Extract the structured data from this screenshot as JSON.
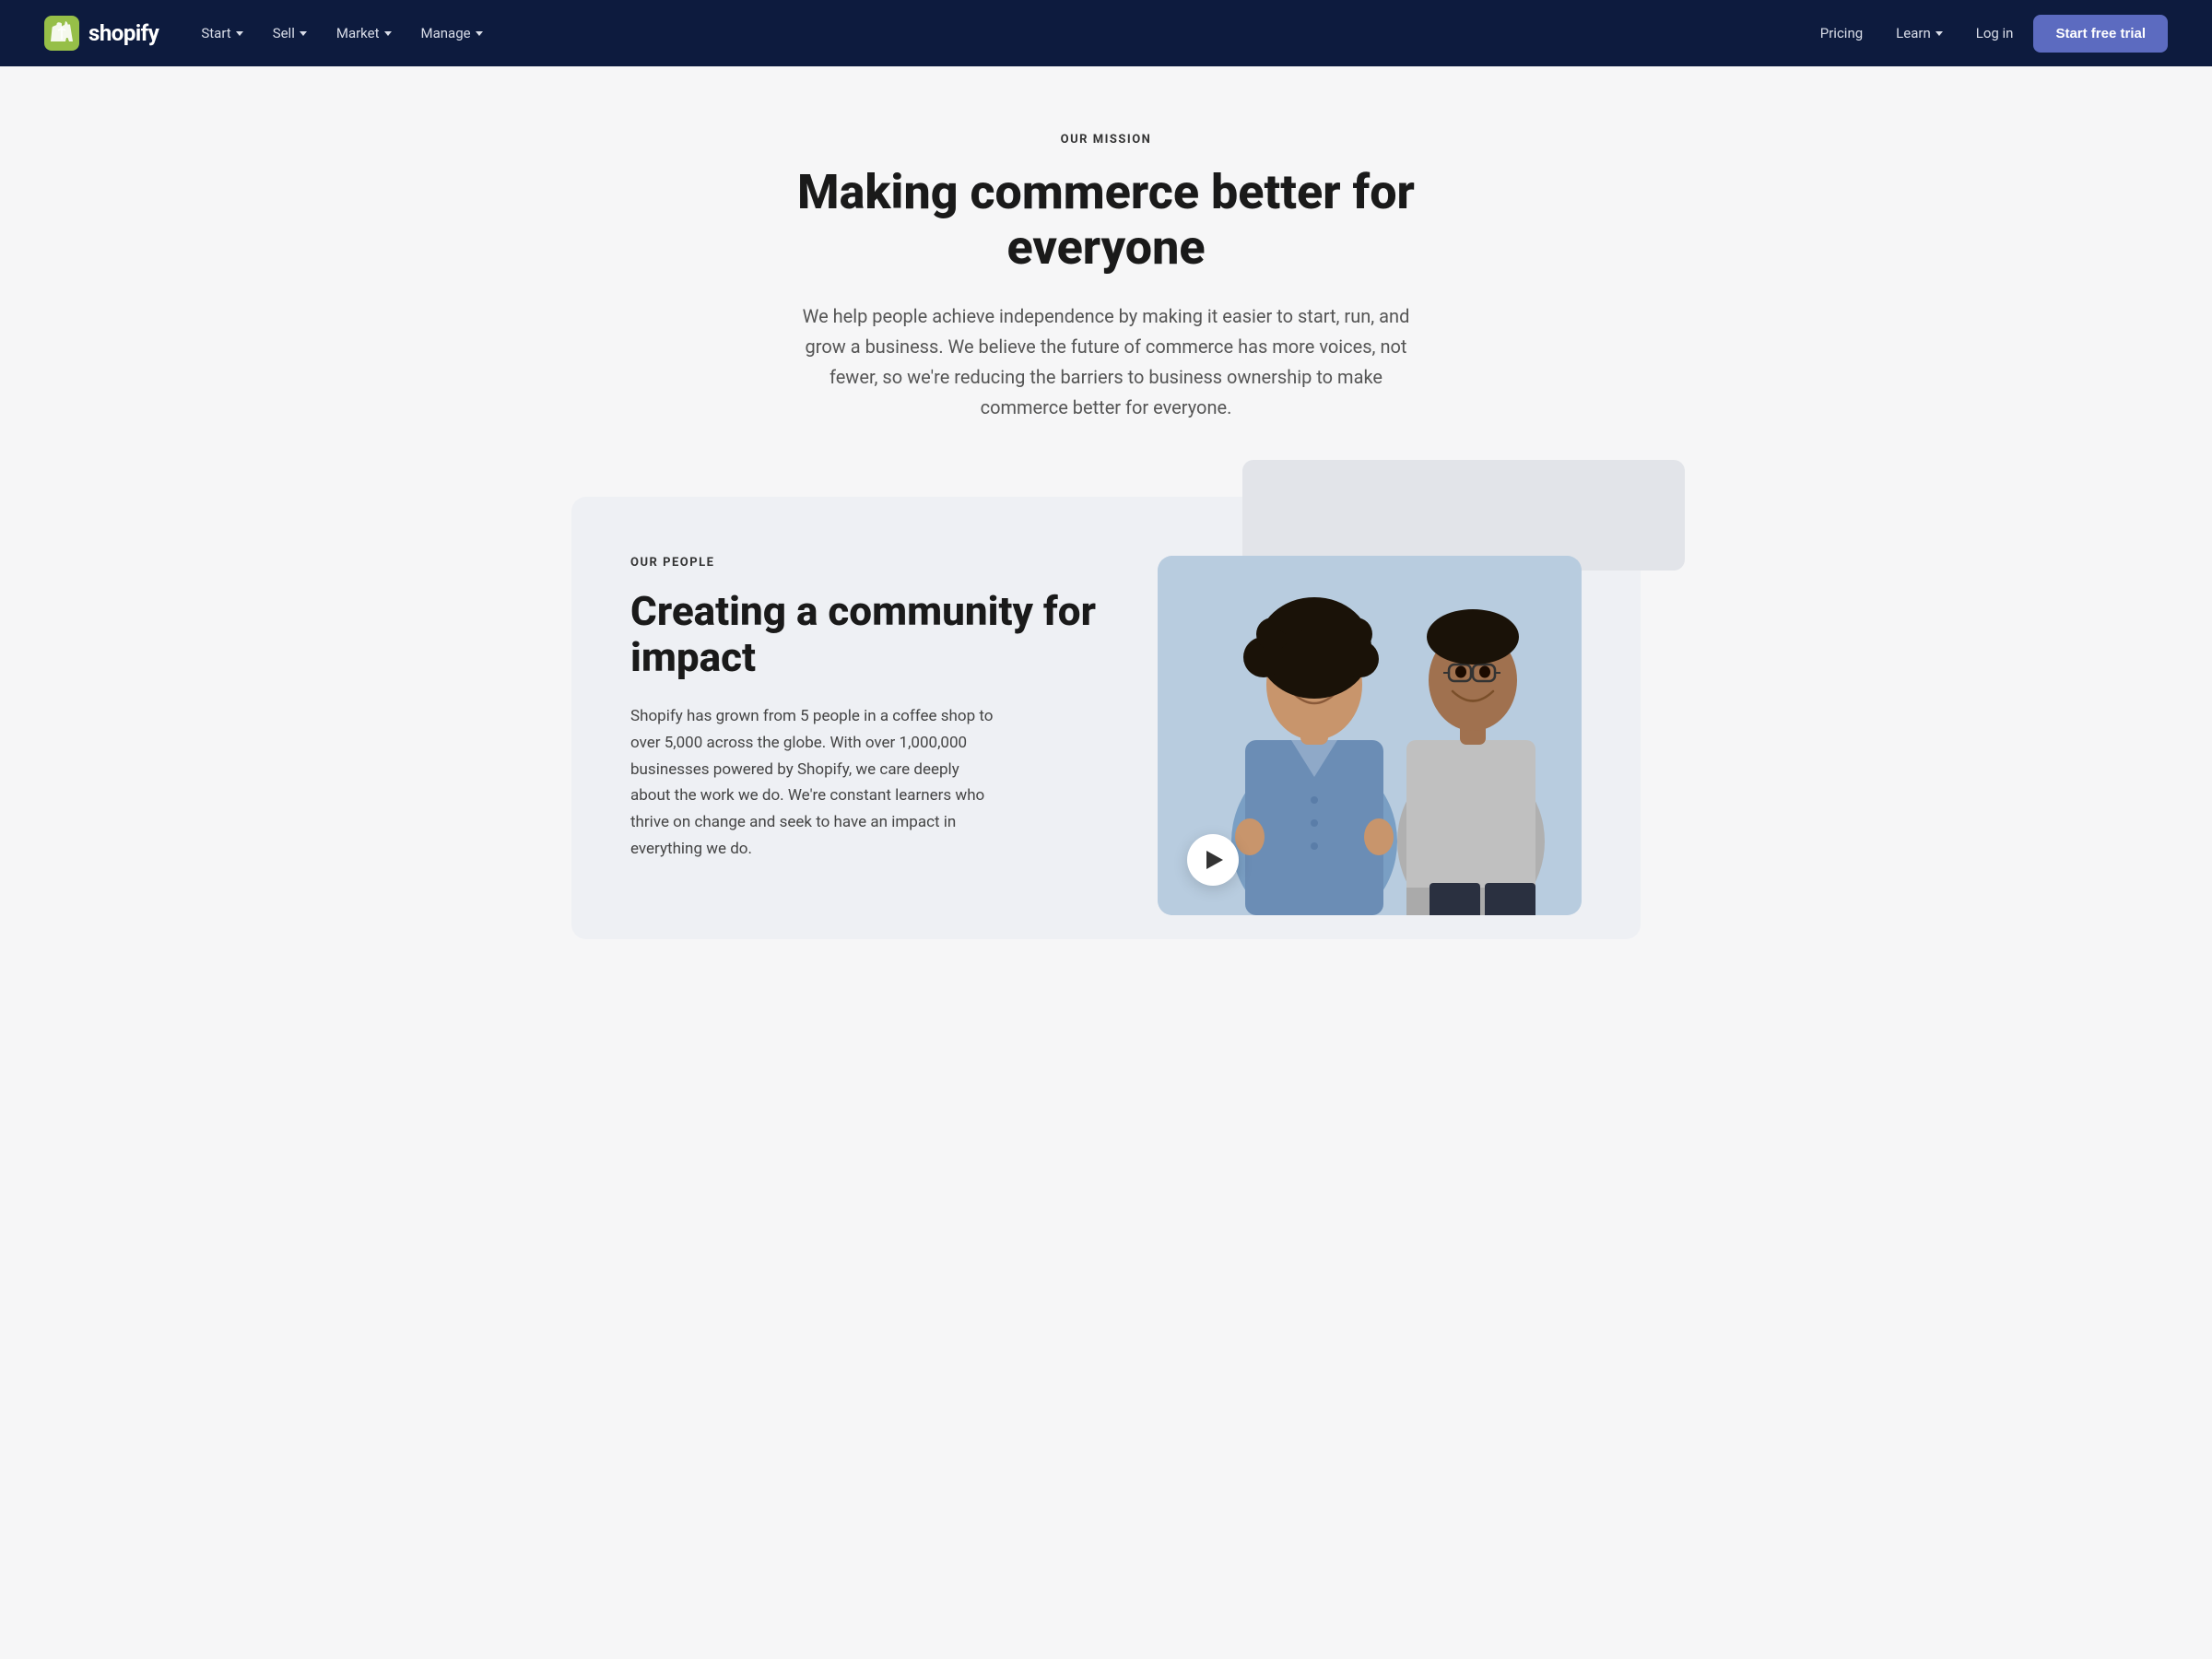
{
  "nav": {
    "logo_text": "shopify",
    "items_left": [
      {
        "label": "Start",
        "has_chevron": true
      },
      {
        "label": "Sell",
        "has_chevron": true
      },
      {
        "label": "Market",
        "has_chevron": true
      },
      {
        "label": "Manage",
        "has_chevron": true
      }
    ],
    "pricing_label": "Pricing",
    "learn_label": "Learn",
    "login_label": "Log in",
    "cta_label": "Start free trial"
  },
  "hero": {
    "section_label": "OUR MISSION",
    "title": "Making commerce better for everyone",
    "description": "We help people achieve independence by making it easier to start, run, and grow a business. We believe the future of commerce has more voices, not fewer, so we're reducing the barriers to business ownership to make commerce better for everyone."
  },
  "people": {
    "section_label": "OUR PEOPLE",
    "title": "Creating a community for impact",
    "description": "Shopify has grown from 5 people in a coffee shop to over 5,000 across the globe. With over 1,000,000 businesses powered by Shopify, we care deeply about the work we do. We're constant learners who thrive on change and seek to have an impact in everything we do."
  }
}
